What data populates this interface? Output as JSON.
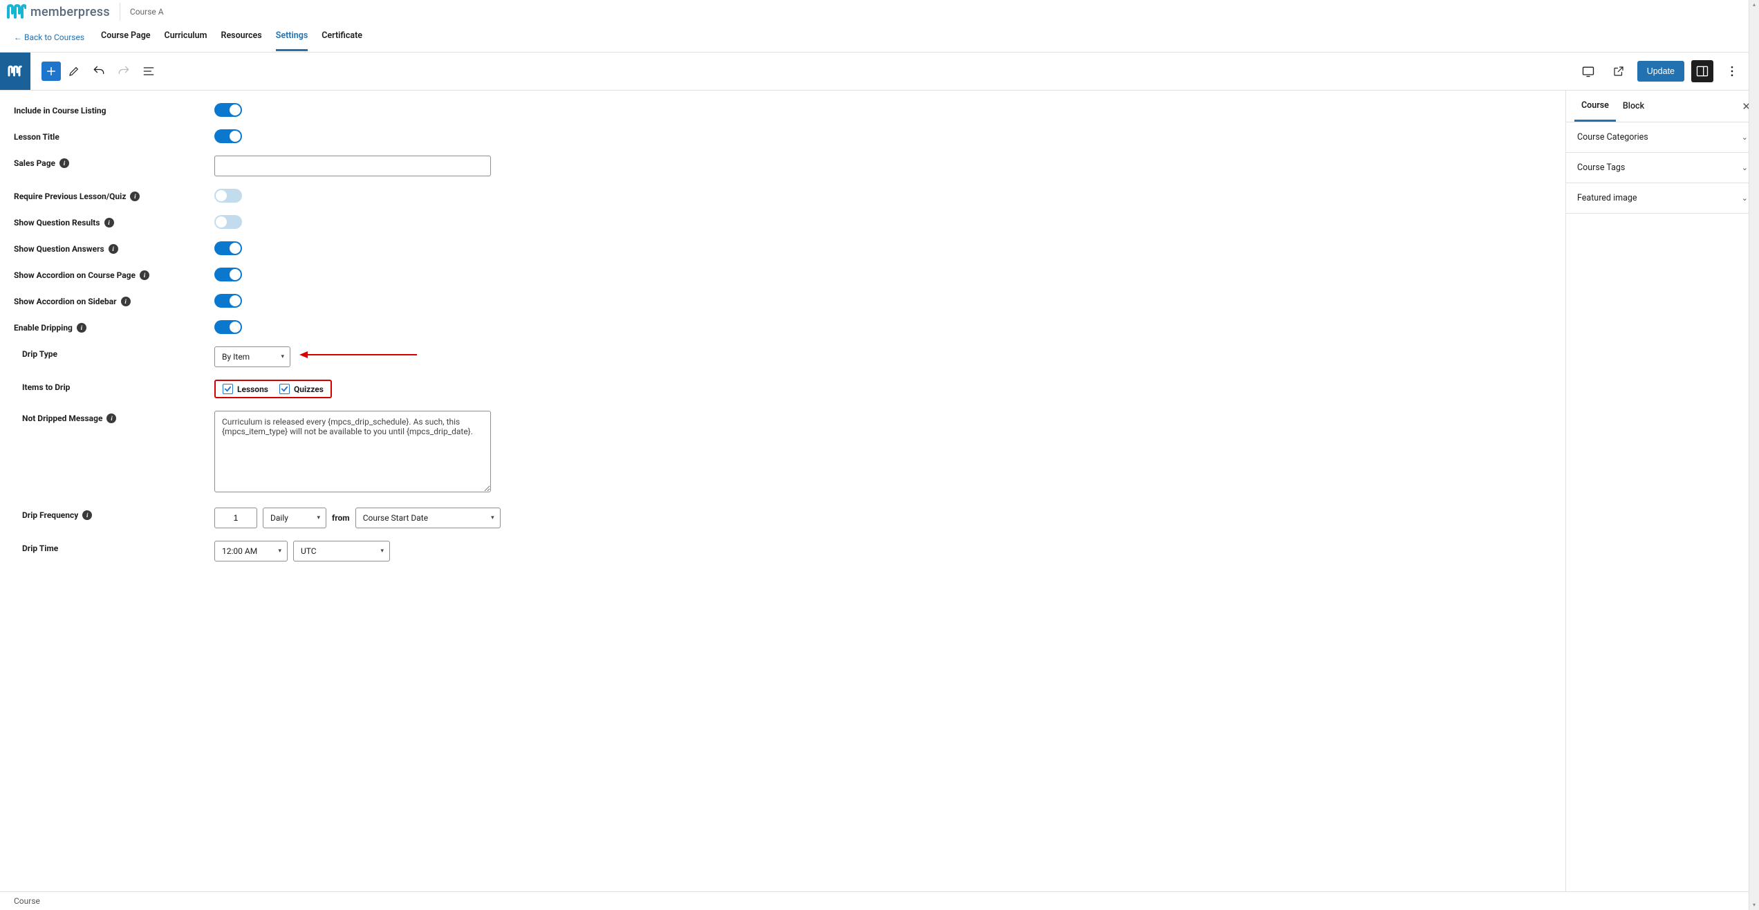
{
  "header": {
    "brand": "memberpress",
    "course_name": "Course A"
  },
  "nav": {
    "back": "← Back to Courses",
    "tabs": [
      "Course Page",
      "Curriculum",
      "Resources",
      "Settings",
      "Certificate"
    ],
    "active_tab": "Settings"
  },
  "editor_toolbar": {
    "update": "Update"
  },
  "settings": {
    "include_in_listing": {
      "label": "Include in Course Listing",
      "on": true
    },
    "lesson_title": {
      "label": "Lesson Title",
      "on": true
    },
    "sales_page": {
      "label": "Sales Page",
      "value": ""
    },
    "require_prev": {
      "label": "Require Previous Lesson/Quiz",
      "on": false
    },
    "show_q_results": {
      "label": "Show Question Results",
      "on": false
    },
    "show_q_answers": {
      "label": "Show Question Answers",
      "on": true
    },
    "show_acc_course": {
      "label": "Show Accordion on Course Page",
      "on": true
    },
    "show_acc_sidebar": {
      "label": "Show Accordion on Sidebar",
      "on": true
    },
    "enable_dripping": {
      "label": "Enable Dripping",
      "on": true
    },
    "drip_type": {
      "label": "Drip Type",
      "value": "By Item"
    },
    "items_to_drip": {
      "label": "Items to Drip",
      "lessons": {
        "label": "Lessons",
        "checked": true
      },
      "quizzes": {
        "label": "Quizzes",
        "checked": true
      }
    },
    "not_dripped_msg": {
      "label": "Not Dripped Message",
      "value": "Curriculum is released every {mpcs_drip_schedule}. As such, this {mpcs_item_type} will not be available to you until {mpcs_drip_date}."
    },
    "drip_frequency": {
      "label": "Drip Frequency",
      "amount": "1",
      "unit": "Daily",
      "from_label": "from",
      "from_value": "Course Start Date"
    },
    "drip_time": {
      "label": "Drip Time",
      "time": "12:00 AM",
      "tz": "UTC"
    }
  },
  "sidebar": {
    "tabs": [
      "Course",
      "Block"
    ],
    "panels": [
      "Course Categories",
      "Course Tags",
      "Featured image"
    ]
  },
  "status": {
    "text": "Course"
  }
}
